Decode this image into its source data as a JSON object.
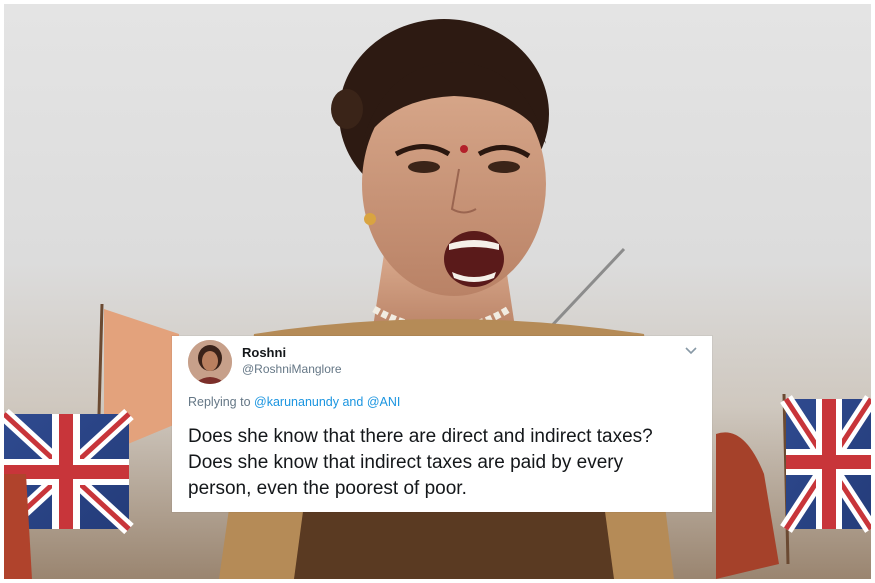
{
  "tweet": {
    "author_name": "Roshni",
    "author_handle": "@RoshniManglore",
    "replying_prefix": "Replying to",
    "reply_mention_1": "@karunanundy",
    "reply_conjunction": "and",
    "reply_mention_2": "@ANI",
    "text_line_1": "Does she know that there are direct and indirect taxes?",
    "text_line_2": "Does she know that indirect taxes are paid by every",
    "text_line_3": "person, even the poorest of poor.",
    "menu_icon": "chevron-down-icon"
  },
  "colors": {
    "link": "#1b95e0",
    "secondary_text": "#657786",
    "primary_text": "#14171a",
    "card_background": "#ffffff"
  }
}
